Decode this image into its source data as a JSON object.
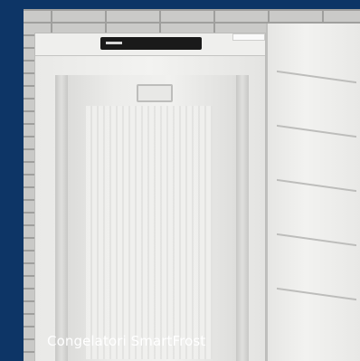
{
  "card": {
    "caption": "Congelatori SmartFrost",
    "accent_color": "#0d3566"
  },
  "image": {
    "subject_icon": "freezer-photo-icon"
  }
}
